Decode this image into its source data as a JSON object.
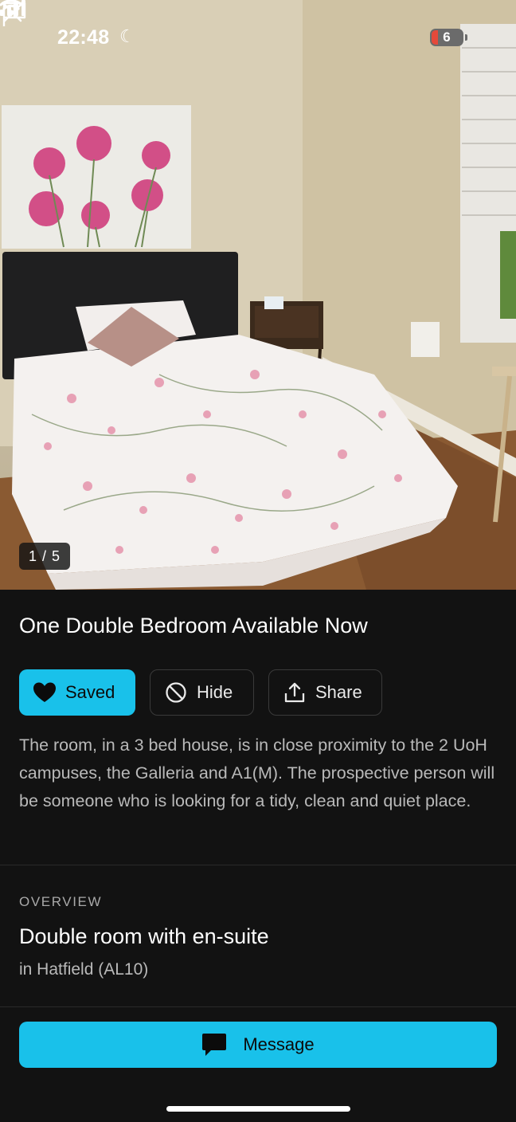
{
  "status_bar": {
    "time": "22:48",
    "battery": "6"
  },
  "photo": {
    "counter": "1 / 5",
    "description": "bedroom photo"
  },
  "listing": {
    "title": "One Double Bedroom Available Now",
    "actions": {
      "saved_label": "Saved",
      "hide_label": "Hide",
      "share_label": "Share"
    },
    "description": "The room, in a 3 bed house, is in close proximity to the 2 UoH campuses, the Galleria and A1(M). The prospective person will be someone who is looking for a tidy, clean and quiet place."
  },
  "overview": {
    "label": "OVERVIEW",
    "room_type": "Double room with en-suite",
    "location": "in Hatfield (AL10)"
  },
  "footer": {
    "message_label": "Message"
  },
  "colors": {
    "accent": "#19c1ea",
    "background": "#121212",
    "text_secondary": "#b9b9b9"
  }
}
